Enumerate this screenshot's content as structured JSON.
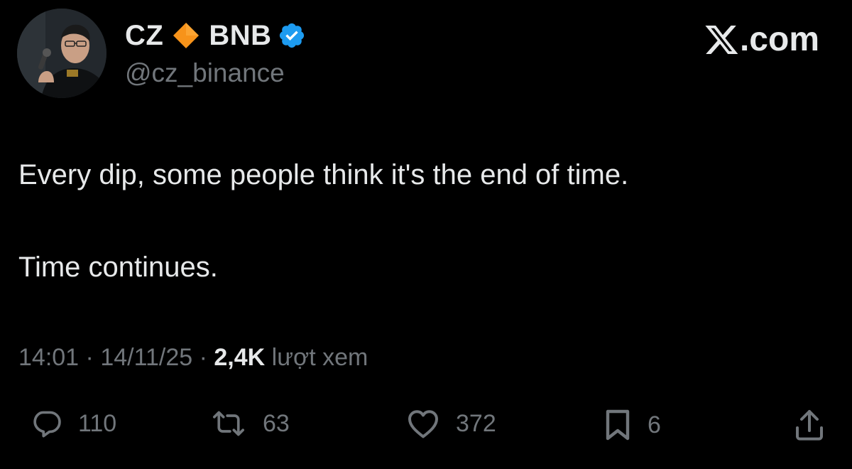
{
  "author": {
    "display_name": "CZ",
    "affiliation": "BNB",
    "handle": "@cz_binance"
  },
  "brand": {
    "site": ".com"
  },
  "tweet": {
    "lines": [
      "Every dip, some people think it's the end of time.",
      "Time continues."
    ]
  },
  "meta": {
    "time": "14:01",
    "separator": " · ",
    "date": "14/11/25",
    "views_count": "2,4K",
    "views_label": " lượt xem"
  },
  "actions": {
    "replies": "110",
    "reposts": "63",
    "likes": "372",
    "bookmarks": "6"
  },
  "colors": {
    "background": "#000000",
    "text": "#e7e9ea",
    "muted": "#71767b",
    "verified": "#1d9bf0",
    "bnb_diamond": "#f7931a"
  },
  "icons": {
    "avatar": "profile-photo",
    "diamond": "orange-diamond-emoji",
    "verified": "verified-badge-icon",
    "brand": "x-logo-icon",
    "reply": "reply-icon",
    "repost": "repost-icon",
    "like": "heart-icon",
    "bookmark": "bookmark-icon",
    "share": "share-icon"
  }
}
